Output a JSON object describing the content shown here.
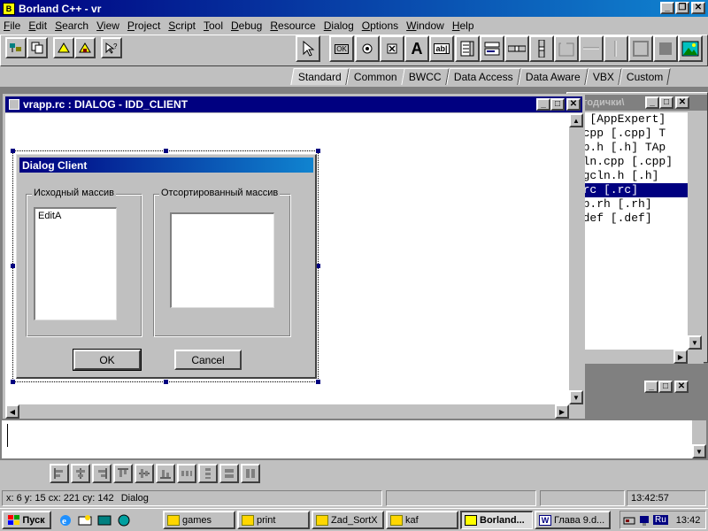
{
  "app": {
    "title": "Borland C++ - vr",
    "menu": [
      "File",
      "Edit",
      "Search",
      "View",
      "Project",
      "Script",
      "Tool",
      "Debug",
      "Resource",
      "Dialog",
      "Options",
      "Window",
      "Help"
    ]
  },
  "palette_tabs": [
    {
      "label": "Standard",
      "active": true
    },
    {
      "label": "Common",
      "active": false
    },
    {
      "label": "BWCC",
      "active": false
    },
    {
      "label": "Data Access",
      "active": false
    },
    {
      "label": "Data Aware",
      "active": false
    },
    {
      "label": "VBX",
      "active": false
    },
    {
      "label": "Custom",
      "active": false
    }
  ],
  "palette_controls": {
    "ok_label": "OK",
    "text_label": "A",
    "edit_label": "ab|"
  },
  "project_window": {
    "title": "годички\\",
    "lines": [
      {
        "text": "xe [AppExpert]",
        "selected": false
      },
      {
        "text": "p.cpp [.cpp]  T",
        "selected": false
      },
      {
        "text": "app.h [.h]  TAp",
        "selected": false
      },
      {
        "text": "gcln.cpp [.cpp]",
        "selected": false
      },
      {
        "text": "dlgcln.h [.h]",
        "selected": false
      },
      {
        "text": "p.rc [.rc]",
        "selected": true
      },
      {
        "text": "app.rh [.rh]",
        "selected": false
      },
      {
        "text": "p.def [.def]",
        "selected": false
      }
    ]
  },
  "editor": {
    "title": "vrapp.rc : DIALOG - IDD_CLIENT"
  },
  "dialog": {
    "title": "Dialog Client",
    "group_left": "Исходный массив",
    "group_right": "Отсортированный массив",
    "list_left_item": "EditA",
    "ok_label": "OK",
    "cancel_label": "Cancel"
  },
  "status": {
    "coords": "x: 6  y: 15  cx: 221  cy: 142",
    "object": "Dialog",
    "time": "13:42:57"
  },
  "taskbar": {
    "start_label": "Пуск",
    "tasks": [
      {
        "label": "games",
        "active": false
      },
      {
        "label": "print",
        "active": false
      },
      {
        "label": "Zad_SortX",
        "active": false
      },
      {
        "label": "kaf",
        "active": false
      },
      {
        "label": "Borland...",
        "active": true
      },
      {
        "label": "Глава 9.d...",
        "active": false
      }
    ],
    "lang": "Ru",
    "clock": "13:42"
  }
}
